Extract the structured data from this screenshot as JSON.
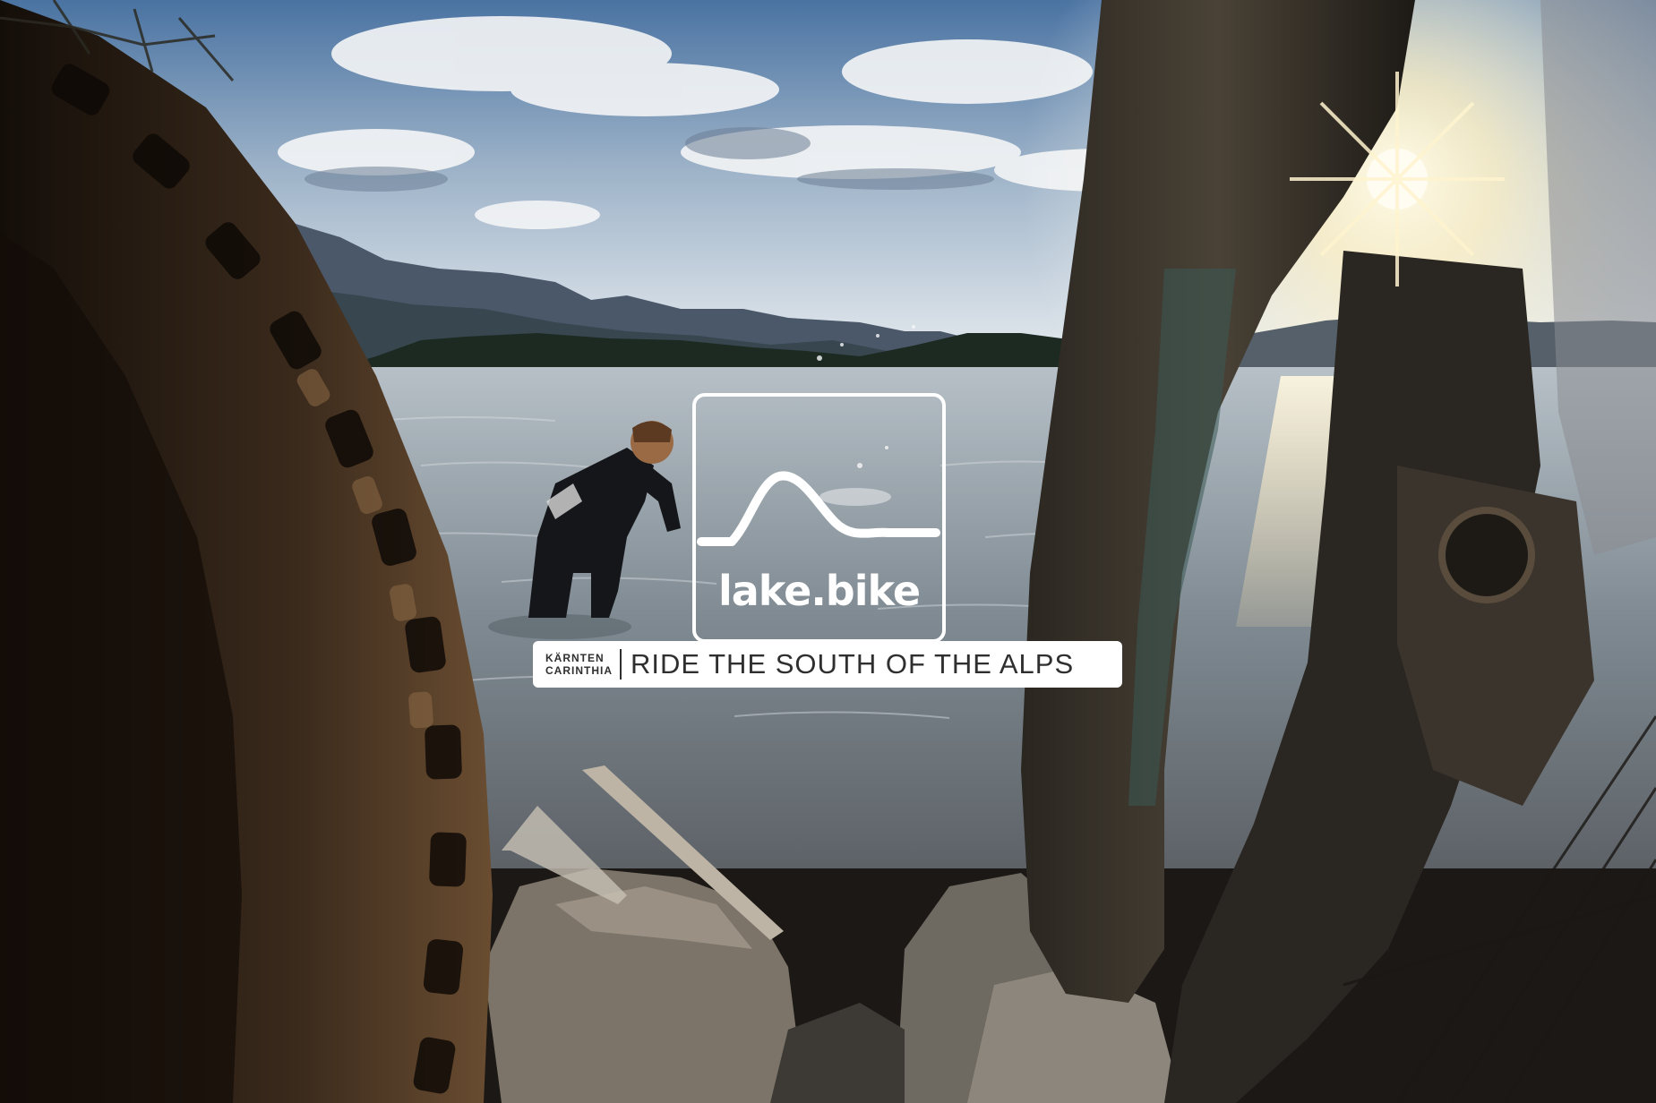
{
  "logo": {
    "wordmark": "lake.bike",
    "icon": "mountain-outline-icon"
  },
  "tagline": {
    "region_primary": "KÄRNTEN",
    "region_secondary": "CARINTHIA",
    "slogan": "RIDE THE SOUTH OF THE ALPS"
  },
  "scene": {
    "subject": "person-skipping-stones-icon",
    "colors": {
      "sky_top": "#4f79a8",
      "sky_horizon": "#e9edf1",
      "lake": "#8f9aa2",
      "sun": "#fff6d8",
      "tire": "#2a1f17",
      "rock": "#7b736a"
    }
  }
}
